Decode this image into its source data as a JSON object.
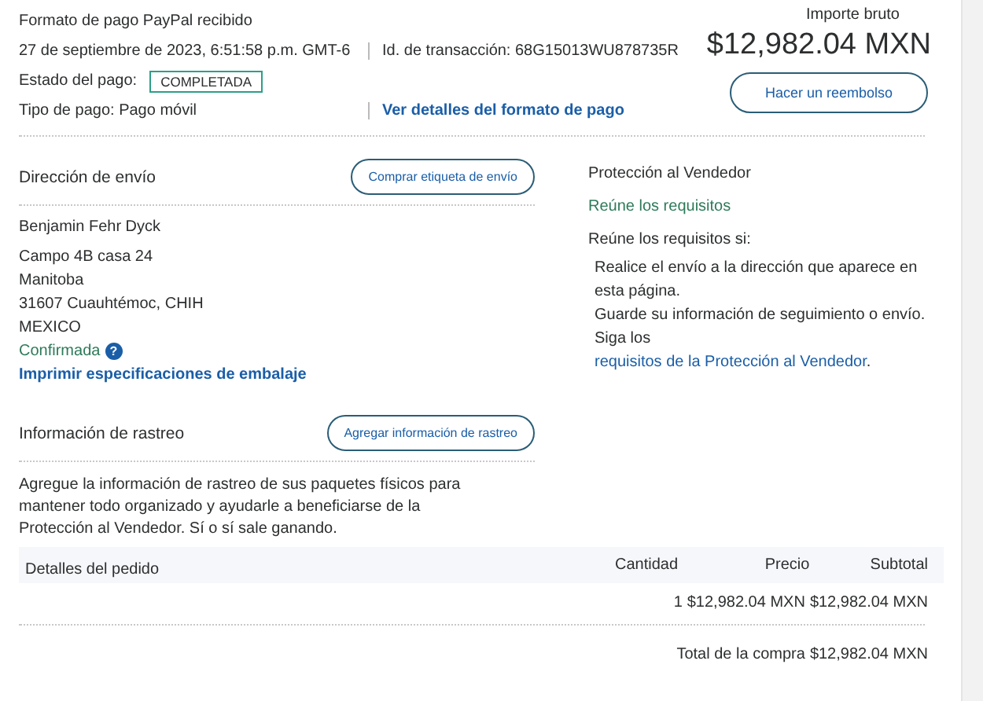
{
  "header": {
    "title": "Formato de pago PayPal recibido",
    "date": "27 de septiembre de 2023, 6:51:58 p.m. GMT-6",
    "transaction": "Id. de transacción: 68G15013WU878735R",
    "status_label": "Estado del pago:",
    "status": "COMPLETADA",
    "payment_type": "Tipo de pago: Pago móvil",
    "details_link": "Ver detalles del formato de pago",
    "gross_label": "Importe bruto",
    "gross_amount": "$12,982.04 MXN",
    "refund_button": "Hacer un reembolso"
  },
  "shipping": {
    "title": "Dirección de envío",
    "button": "Comprar etiqueta de envío",
    "name": "Benjamin Fehr Dyck",
    "address": [
      "Campo 4B casa 24",
      "Manitoba",
      "31607 Cuauhtémoc, CHIH",
      "MEXICO"
    ],
    "confirmation": "Confirmada",
    "help_icon": "?",
    "print_link": "Imprimir especificaciones de embalaje"
  },
  "protection": {
    "title": "Protección al Vendedor",
    "status": "Reúne los requisitos",
    "intro": "Reúne los requisitos si:",
    "requirements": [
      {
        "text": "Realice el envío a la dirección que aparece en esta página."
      },
      {
        "text": "Guarde su información de seguimiento o envío."
      },
      {
        "text": "Siga los ",
        "link": "requisitos de la Protección al Vendedor",
        "suffix": "."
      }
    ]
  },
  "tracking": {
    "title": "Información de rastreo",
    "button": "Agregar información de rastreo",
    "description": "Agregue la información de rastreo de sus paquetes físicos para mantener todo organizado y ayudarle a beneficiarse de la Protección al Vendedor. Sí o sí sale ganando."
  },
  "order": {
    "columns": [
      "Detalles del pedido",
      "Cantidad",
      "Precio",
      "Subtotal"
    ],
    "rows": [
      {
        "quantity": "1",
        "price": "$12,982.04 MXN",
        "subtotal": "$12,982.04 MXN"
      }
    ],
    "total_label": "Total de la compra",
    "total": "$12,982.04 MXN"
  }
}
